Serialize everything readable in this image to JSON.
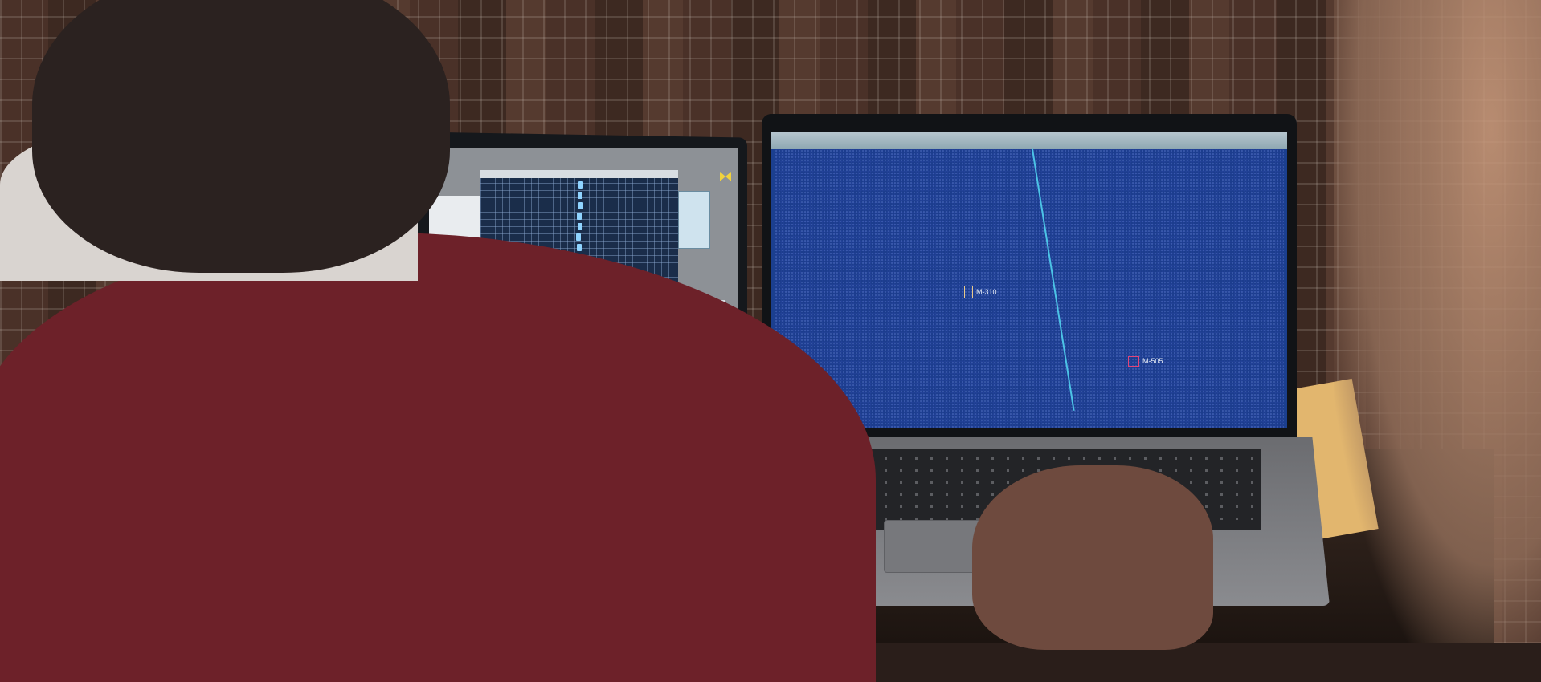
{
  "scene": {
    "description_free": true,
    "right_screen": {
      "targets": [
        {
          "label": "M-310",
          "color": "#e8c98a"
        },
        {
          "label": "M-505",
          "color": "#e0457b"
        }
      ],
      "track_color": "#4cc3e6",
      "plot_color": "#1c3d8e"
    },
    "left_screen": {
      "grid_color": "#1a2d4a",
      "signal_color": "#8fd4ff"
    },
    "colors": {
      "shirt": "#6d2129",
      "wall": "#4a3128"
    }
  }
}
